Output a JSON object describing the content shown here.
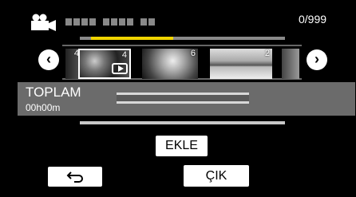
{
  "header": {
    "mode_icon": "video-camera-icon",
    "counter": "0/999"
  },
  "progress": {
    "value": 0.4
  },
  "thumbnails": [
    {
      "number": "4"
    },
    {
      "number": "4"
    },
    {
      "number": "6"
    },
    {
      "number": "2"
    }
  ],
  "nav": {
    "prev_icon": "chevron-left-circle-icon",
    "next_icon": "chevron-right-circle-icon"
  },
  "total": {
    "label": "TOPLAM",
    "time": "00h00m"
  },
  "buttons": {
    "add_label": "EKLE",
    "back_icon": "return-arrow-icon",
    "exit_label": "ÇIK"
  },
  "colors": {
    "background": "#000000",
    "progress_fill": "#f0d400",
    "panel": "#6b6b6b"
  }
}
